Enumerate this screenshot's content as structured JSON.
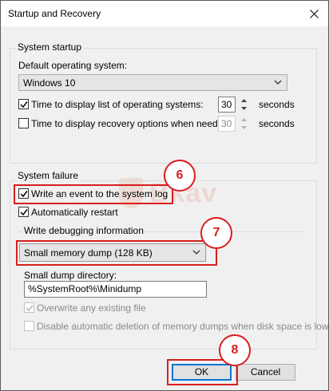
{
  "window": {
    "title": "Startup and Recovery"
  },
  "system_startup": {
    "group_label": "System startup",
    "default_os_label": "Default operating system:",
    "default_os_value": "Windows 10",
    "display_list": {
      "label": "Time to display list of operating systems:",
      "checked": true,
      "value": "30",
      "unit": "seconds"
    },
    "display_recovery": {
      "label": "Time to display recovery options when needed:",
      "checked": false,
      "value": "30",
      "unit": "seconds"
    }
  },
  "system_failure": {
    "group_label": "System failure",
    "write_event": {
      "label": "Write an event to the system log",
      "checked": true
    },
    "auto_restart": {
      "label": "Automatically restart",
      "checked": true
    }
  },
  "debugging": {
    "group_label": "Write debugging information",
    "dump_type": "Small memory dump (128 KB)",
    "dump_dir_label": "Small dump directory:",
    "dump_dir_value": "%SystemRoot%\\Minidump",
    "overwrite": {
      "label": "Overwrite any existing file",
      "checked": true,
      "disabled": true
    },
    "disable_auto_delete": {
      "label": "Disable automatic deletion of memory dumps when disk space is low",
      "checked": false,
      "disabled": true
    }
  },
  "buttons": {
    "ok": "OK",
    "cancel": "Cancel"
  },
  "annotations": {
    "step6": "6",
    "step7": "7",
    "step8": "8"
  },
  "watermark": {
    "text": "Bkav"
  },
  "colors": {
    "highlight_red": "#d91e1e",
    "accent_blue": "#0078d7",
    "dialog_bg": "#f0f0f0"
  }
}
